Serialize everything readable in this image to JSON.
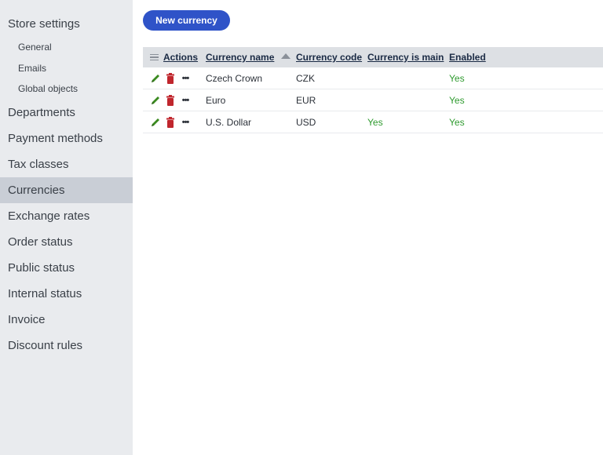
{
  "sidebar": {
    "items": [
      {
        "label": "Store settings"
      },
      {
        "label": "General"
      },
      {
        "label": "Emails"
      },
      {
        "label": "Global objects"
      },
      {
        "label": "Departments"
      },
      {
        "label": "Payment methods"
      },
      {
        "label": "Tax classes"
      },
      {
        "label": "Currencies",
        "active": true
      },
      {
        "label": "Exchange rates"
      },
      {
        "label": "Order status"
      },
      {
        "label": "Public status"
      },
      {
        "label": "Internal status"
      },
      {
        "label": "Invoice"
      },
      {
        "label": "Discount rules"
      }
    ]
  },
  "toolbar": {
    "new_button_label": "New currency"
  },
  "grid": {
    "columns": {
      "actions": "Actions",
      "name": "Currency name",
      "code": "Currency code",
      "is_main": "Currency is main",
      "enabled": "Enabled"
    },
    "sort": {
      "column": "Currency name",
      "direction": "ascending"
    },
    "rows": [
      {
        "name": "Czech Crown",
        "code": "CZK",
        "is_main": "",
        "enabled": "Yes"
      },
      {
        "name": "Euro",
        "code": "EUR",
        "is_main": "",
        "enabled": "Yes"
      },
      {
        "name": "U.S. Dollar",
        "code": "USD",
        "is_main": "Yes",
        "enabled": "Yes"
      }
    ],
    "icons": {
      "edit": "pencil-icon",
      "delete": "trash-icon",
      "more": "ellipsis-icon",
      "column_menu": "hamburger-menu-icon",
      "sort": "sort-ascending-icon"
    }
  },
  "colors": {
    "sidebar_bg": "#e9ebee",
    "sidebar_active": "#c9ced6",
    "primary_button": "#2f53c8",
    "header_bg": "#dde0e4",
    "yes_text": "#2e9a2e",
    "edit_icon": "#3a8a1f",
    "delete_icon": "#c0262d"
  }
}
